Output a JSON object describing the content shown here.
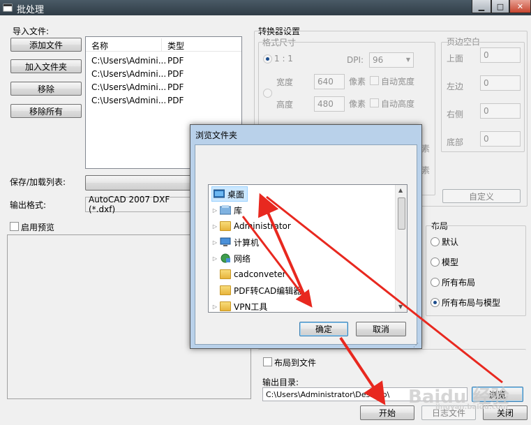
{
  "window": {
    "title": "批处理",
    "min_label": "▁",
    "max_label": "□",
    "close_label": "✕"
  },
  "left": {
    "import_label": "导入文件:",
    "buttons": [
      "添加文件",
      "加入文件夹",
      "移除",
      "移除所有"
    ],
    "columns": [
      "名称",
      "类型"
    ],
    "files": [
      {
        "name": "C:\\Users\\Admini...",
        "type": "PDF"
      },
      {
        "name": "C:\\Users\\Admini...",
        "type": "PDF"
      },
      {
        "name": "C:\\Users\\Admini...",
        "type": "PDF"
      },
      {
        "name": "C:\\Users\\Admini...",
        "type": "PDF"
      }
    ],
    "save_list_label": "保存/加载列表:",
    "output_format_label": "输出格式:",
    "output_format_value": "AutoCAD 2007 DXF (*.dxf)",
    "preview_label": "启用预览"
  },
  "converter": {
    "group_label": "转换器设置",
    "format_size_label": "格式尺寸",
    "ratio_label": "1 : 1",
    "dpi_label": "DPI:",
    "dpi_value": "96",
    "width_label": "宽度",
    "width_value": "640",
    "height_label": "高度",
    "height_value": "480",
    "pixel_label": "像素",
    "auto_width_label": "自动宽度",
    "auto_height_label": "自动高度",
    "pixel_partial": "素",
    "margins_label": "页边空白",
    "margins": [
      {
        "label": "上面",
        "value": "0"
      },
      {
        "label": "左边",
        "value": "0"
      },
      {
        "label": "右侧",
        "value": "0"
      },
      {
        "label": "底部",
        "value": "0"
      }
    ],
    "custom_button": "自定义",
    "layout_label": "布局",
    "layout_options": [
      "默认",
      "模型",
      "所有布局",
      "所有布局与模型"
    ],
    "layout_selected": 3,
    "layout_to_file_label": "布局到文件",
    "output_dir_label": "输出目录:",
    "output_dir_value": "C:\\Users\\Administrator\\Desktop\\",
    "browse_button": "浏览"
  },
  "footer": {
    "start_button": "开始",
    "log_button": "日志文件",
    "close_button": "关闭"
  },
  "dialog": {
    "title": "浏览文件夹",
    "tree": [
      {
        "label": "桌面",
        "icon": "desktop-icon",
        "level": 0,
        "expander": false,
        "selected": true
      },
      {
        "label": "库",
        "icon": "library-icon",
        "level": 1,
        "expander": true
      },
      {
        "label": "Administrator",
        "icon": "user-folder-icon",
        "level": 1,
        "expander": true
      },
      {
        "label": "计算机",
        "icon": "computer-icon",
        "level": 1,
        "expander": true
      },
      {
        "label": "网络",
        "icon": "network-icon",
        "level": 1,
        "expander": true
      },
      {
        "label": "cadconveter",
        "icon": "folder-icon",
        "level": 1,
        "expander": false
      },
      {
        "label": "PDF转CAD编辑器",
        "icon": "folder-icon",
        "level": 1,
        "expander": false
      },
      {
        "label": "VPN工具",
        "icon": "folder-icon",
        "level": 1,
        "expander": true
      }
    ],
    "ok_button": "确定",
    "cancel_button": "取消"
  },
  "watermark": {
    "text": "Baidu 经验",
    "url": "jingyan.baidu.com"
  },
  "colors": {
    "arrow": "#e8281f",
    "selection": "#cce8ff",
    "dialog_frame": "#b9d1ea"
  }
}
